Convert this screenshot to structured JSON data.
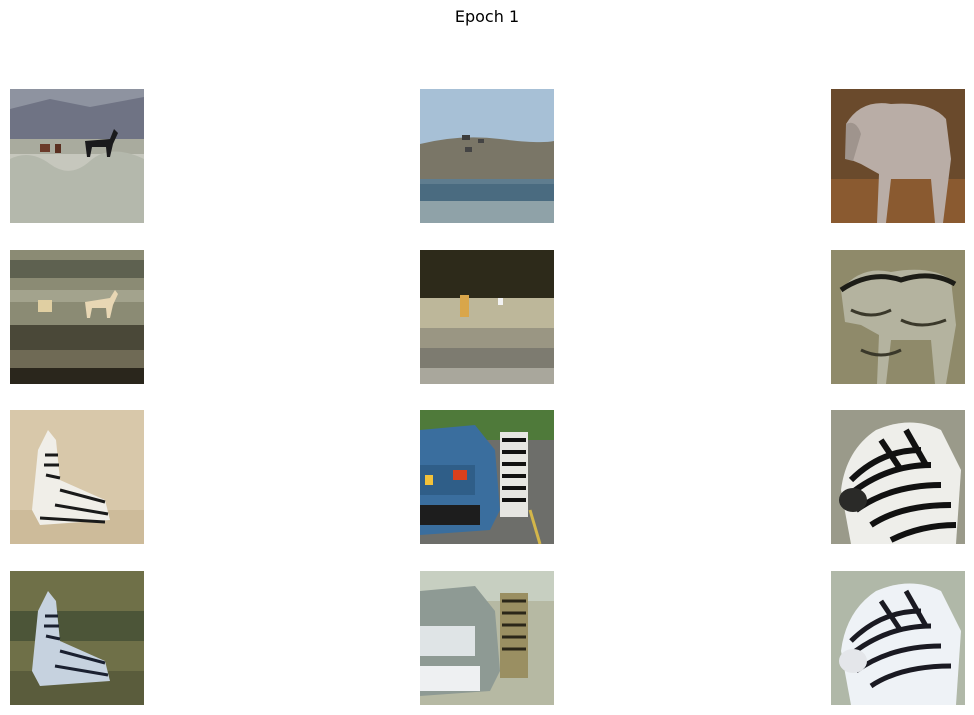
{
  "figure": {
    "title": "Epoch 1"
  },
  "images": [
    {
      "row": 0,
      "col": 0,
      "kind": "photo",
      "subject": "horses"
    },
    {
      "row": 0,
      "col": 1,
      "kind": "photo",
      "subject": "horses"
    },
    {
      "row": 0,
      "col": 2,
      "kind": "photo",
      "subject": "horse"
    },
    {
      "row": 1,
      "col": 0,
      "kind": "generated",
      "subject": "horses"
    },
    {
      "row": 1,
      "col": 1,
      "kind": "generated",
      "subject": "horses"
    },
    {
      "row": 1,
      "col": 2,
      "kind": "generated",
      "subject": "horse"
    },
    {
      "row": 2,
      "col": 0,
      "kind": "photo",
      "subject": "zebra"
    },
    {
      "row": 2,
      "col": 1,
      "kind": "photo",
      "subject": "zebra-and-car"
    },
    {
      "row": 2,
      "col": 2,
      "kind": "photo",
      "subject": "zebra"
    },
    {
      "row": 3,
      "col": 0,
      "kind": "generated",
      "subject": "zebra"
    },
    {
      "row": 3,
      "col": 1,
      "kind": "generated",
      "subject": "zebra-and-car"
    },
    {
      "row": 3,
      "col": 2,
      "kind": "generated",
      "subject": "zebra"
    }
  ]
}
